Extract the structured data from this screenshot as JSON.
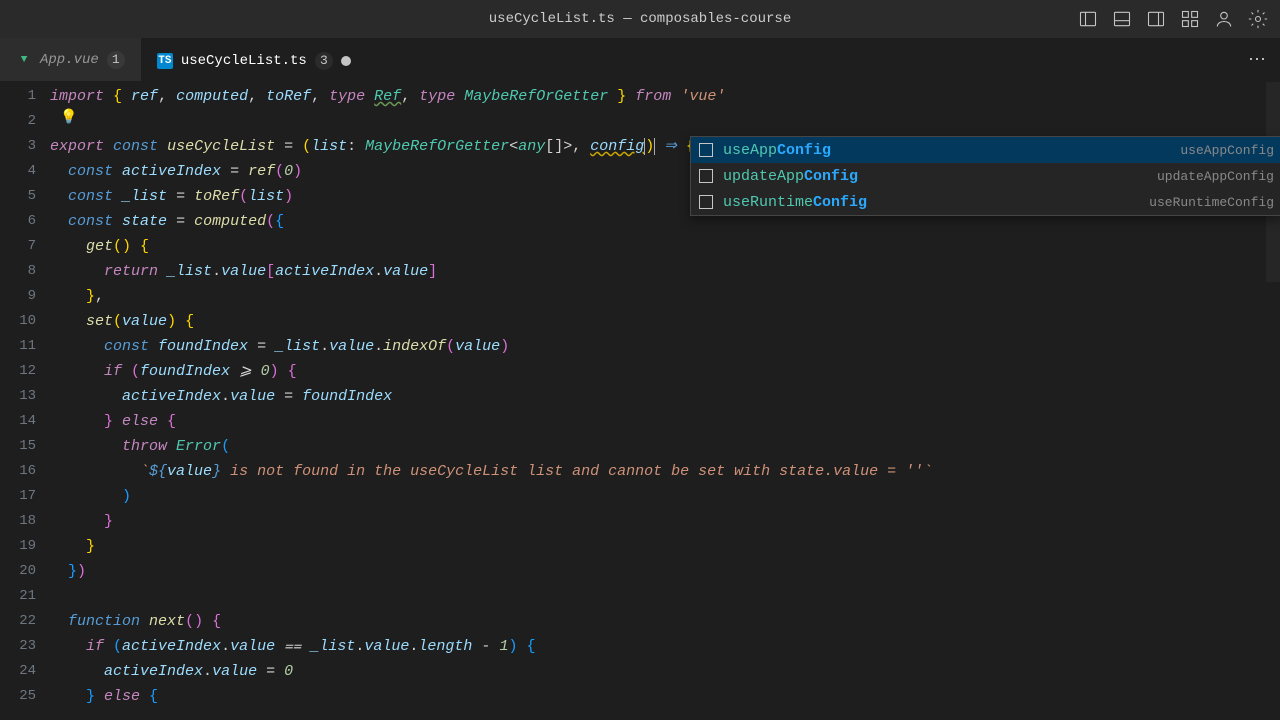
{
  "titlebar": {
    "title": "useCycleList.ts — composables-course"
  },
  "tabs": [
    {
      "icon": "vue",
      "label": "App.vue",
      "badge": "1",
      "active": false,
      "dirty": false
    },
    {
      "icon": "ts",
      "label": "useCycleList.ts",
      "badge": "3",
      "active": true,
      "dirty": true
    }
  ],
  "gutter": [
    "1",
    "2",
    "3",
    "4",
    "5",
    "6",
    "7",
    "8",
    "9",
    "10",
    "11",
    "12",
    "13",
    "14",
    "15",
    "16",
    "17",
    "18",
    "19",
    "20",
    "21",
    "22",
    "23",
    "24",
    "25"
  ],
  "code": {
    "l1": {
      "import": "import",
      "lb": "{ ",
      "ref": "ref",
      "c1": ", ",
      "computed": "computed",
      "c2": ", ",
      "toRef": "toRef",
      "c3": ", ",
      "type1": "type",
      "Ref": "Ref",
      "c4": ", ",
      "type2": "type",
      "MRG": "MaybeRefOrGetter",
      "rb": " }",
      "from": "from",
      "vue": "'vue'"
    },
    "l3": {
      "export": "export",
      "const": "const",
      "name": "useCycleList",
      "eq": " = ",
      "lp": "(",
      "list": "list",
      "colon": ": ",
      "type": "MaybeRefOrGetter",
      "lt": "<",
      "any": "any",
      "arr": "[]",
      "gt": ">",
      "comma": ", ",
      "config": "config",
      "rp": ")",
      "arrow": " ⇒ ",
      "lb": "{"
    },
    "l4": {
      "const": "const",
      "name": "activeIndex",
      "eq": " = ",
      "ref": "ref",
      "lp": "(",
      "zero": "0",
      "rp": ")"
    },
    "l5": {
      "const": "const",
      "name": "_list",
      "eq": " = ",
      "toRef": "toRef",
      "lp": "(",
      "list": "list",
      "rp": ")"
    },
    "l6": {
      "const": "const",
      "name": "state",
      "eq": " = ",
      "computed": "computed",
      "lp": "(",
      "lb": "{"
    },
    "l7": {
      "get": "get",
      "lp": "()",
      "lb": " {"
    },
    "l8": {
      "return": "return",
      "list": "_list",
      "dot1": ".",
      "value1": "value",
      "lbr": "[",
      "ai": "activeIndex",
      "dot2": ".",
      "value2": "value",
      "rbr": "]"
    },
    "l9": {
      "rb": "}",
      "comma": ","
    },
    "l10": {
      "set": "set",
      "lp": "(",
      "value": "value",
      "rp": ")",
      "lb": " {"
    },
    "l11": {
      "const": "const",
      "fi": "foundIndex",
      "eq": " = ",
      "list": "_list",
      "dot1": ".",
      "value": "value",
      "dot2": ".",
      "indexOf": "indexOf",
      "lp": "(",
      "val": "value",
      "rp": ")"
    },
    "l12": {
      "if": "if",
      "lp": " (",
      "fi": "foundIndex",
      "gte": " ⩾ ",
      "zero": "0",
      "rp": ")",
      "lb": " {"
    },
    "l13": {
      "ai": "activeIndex",
      "dot": ".",
      "value": "value",
      "eq": " = ",
      "fi": "foundIndex"
    },
    "l14": {
      "rb": "}",
      "else": " else ",
      "lb": "{"
    },
    "l15": {
      "throw": "throw",
      "Error": "Error",
      "lp": "("
    },
    "l16": {
      "tick": "`",
      "dollar": "${",
      "value": "value",
      "rb": "}",
      "text": " is not found in the useCycleList list and cannot be set with state.value = ''",
      "tick2": "`"
    },
    "l17": {
      "rp": ")"
    },
    "l18": {
      "rb": "}"
    },
    "l19": {
      "rb": "}"
    },
    "l20": {
      "rb": "}",
      "rp": ")"
    },
    "l22": {
      "function": "function",
      "next": "next",
      "lp": "()",
      "lb": " {"
    },
    "l23": {
      "if": "if",
      "lp": " (",
      "ai": "activeIndex",
      "dot1": ".",
      "value1": "value",
      "eqeq": " ⩵ ",
      "list": "_list",
      "dot2": ".",
      "value2": "value",
      "dot3": ".",
      "length": "length",
      "minus": " - ",
      "one": "1",
      "rp": ")",
      "lb": " {"
    },
    "l24": {
      "ai": "activeIndex",
      "dot": ".",
      "value": "value",
      "eq": " = ",
      "zero": "0"
    },
    "l25": {
      "rb": "}",
      "else": " else ",
      "lb": "{"
    }
  },
  "autocomplete": {
    "items": [
      {
        "prefix": "useApp",
        "match": "Config",
        "detail": "useAppConfig"
      },
      {
        "prefix": "updateApp",
        "match": "Config",
        "detail": "updateAppConfig"
      },
      {
        "prefix": "useRuntime",
        "match": "Config",
        "detail": "useRuntimeConfig"
      }
    ]
  }
}
